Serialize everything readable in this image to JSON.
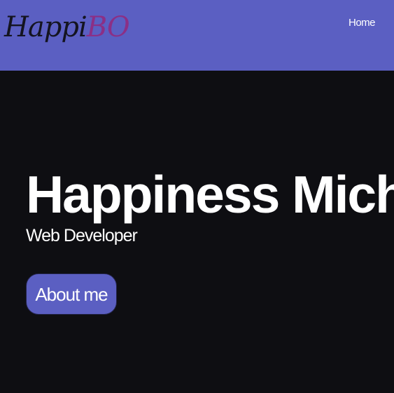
{
  "navbar": {
    "logo": {
      "part1": "Happi",
      "part2": "BO"
    },
    "links": [
      {
        "label": "Home"
      }
    ]
  },
  "hero": {
    "title": "Happiness Michael",
    "subtitle": "Web Developer",
    "cta_label": "About me"
  },
  "colors": {
    "navbar_bg": "#5b5fc2",
    "page_bg": "#0e0e12",
    "logo_dark": "#141420",
    "logo_accent": "#8b2f86",
    "button_bg": "#5b5fc2",
    "text": "#ffffff"
  }
}
